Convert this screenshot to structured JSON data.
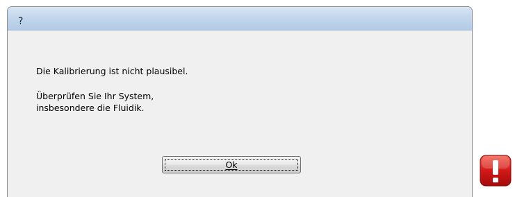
{
  "dialog": {
    "title": "?",
    "message_lines": [
      "Die Kalibrierung ist nicht plausibel.",
      "Überprüfen Sie Ihr System,",
      "insbesondere die Fluidik."
    ],
    "ok_label": "Ok"
  },
  "icons": {
    "alert": "exclamation-warning-icon"
  },
  "colors": {
    "titlebar": "#c3d7ec",
    "dialog_background": "#f0f0f0",
    "alert_red": "#d21818"
  }
}
